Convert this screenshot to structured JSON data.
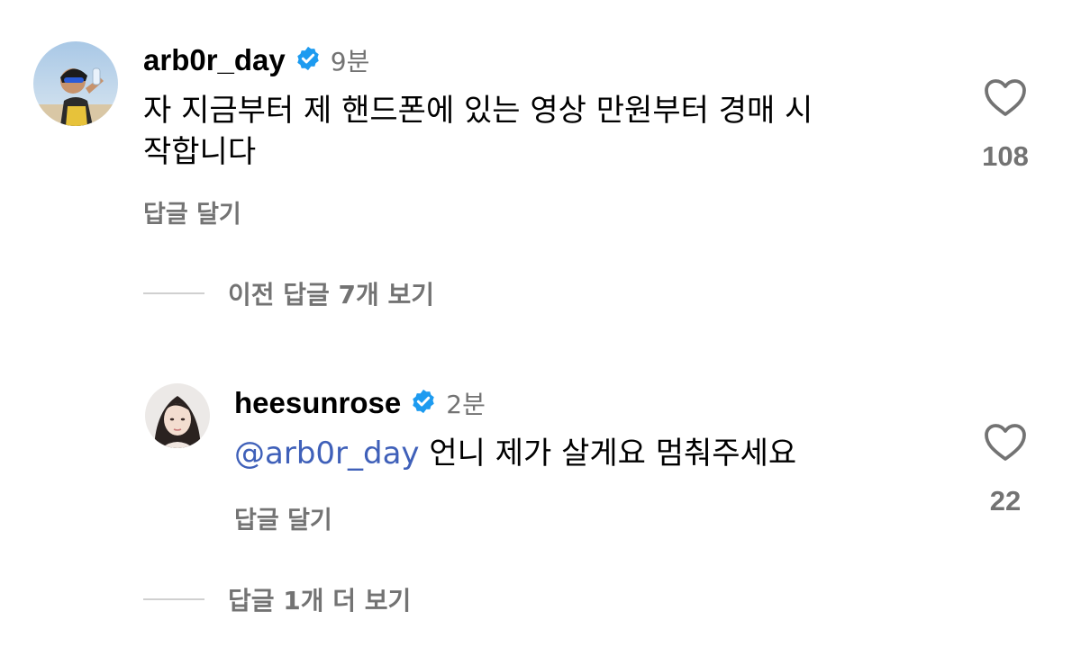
{
  "comments": [
    {
      "username": "arb0r_day",
      "verified": true,
      "time": "9분",
      "text_line1": "자 지금부터 제 핸드폰에 있는 영상 만원부터 경매 시",
      "text_line2": "작합니다",
      "reply_label": "답글 달기",
      "like_count": "108",
      "view_replies_label": "이전 답글 7개 보기"
    },
    {
      "username": "heesunrose",
      "verified": true,
      "time": "2분",
      "mention": "@arb0r_day",
      "text": " 언니 제가 살게요 멈춰주세요",
      "reply_label": "답글 달기",
      "like_count": "22",
      "view_replies_label": "답글 1개 더 보기"
    }
  ],
  "colors": {
    "text": "#000000",
    "secondary": "#737373",
    "verified": "#1d9bf0",
    "mention": "#3f60b9",
    "divider": "#d0d0d0"
  },
  "icons": {
    "verified": "verified-badge-icon",
    "like": "heart-outline-icon"
  }
}
